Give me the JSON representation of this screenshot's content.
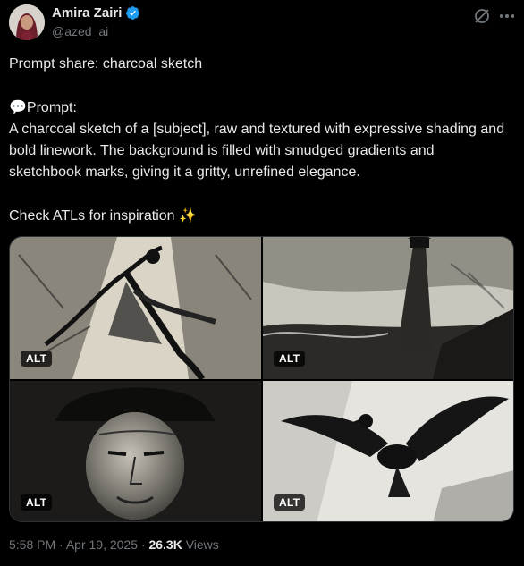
{
  "author": {
    "name": "Amira Zairi",
    "handle": "@azed_ai",
    "verified": true,
    "avatar_icon": "profile-photo-icon"
  },
  "icons": {
    "grok": "grok-icon",
    "more": "more-options-icon",
    "verified": "verified-badge-icon"
  },
  "tweet": {
    "line1": "Prompt share: charcoal sketch",
    "prompt_emoji": "💬",
    "prompt_label": "Prompt:",
    "prompt_text": "A charcoal sketch of a [subject], raw and textured with expressive shading and bold linework. The background is filled with smudged gradients and sketchbook marks, giving it a gritty, unrefined elegance.",
    "closing": "Check ATLs for inspiration",
    "closing_emoji": "✨"
  },
  "media": [
    {
      "alt_label": "ALT"
    },
    {
      "alt_label": "ALT"
    },
    {
      "alt_label": "ALT"
    },
    {
      "alt_label": "ALT"
    }
  ],
  "meta": {
    "time": "5:58 PM",
    "separator": "·",
    "date": "Apr 19, 2025",
    "views_count": "26.3K",
    "views_label": "Views"
  },
  "colors": {
    "background": "#000000",
    "text": "#e7e9ea",
    "muted": "#71767b",
    "verified": "#1d9bf0"
  }
}
